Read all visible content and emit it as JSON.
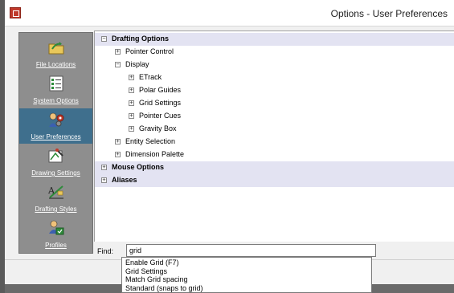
{
  "window": {
    "title": "Options - User Preferences"
  },
  "left_nav": {
    "items": [
      {
        "label": "File Locations",
        "icon": "folder-arrow-icon",
        "selected": false
      },
      {
        "label": "System Options",
        "icon": "checklist-icon",
        "selected": false
      },
      {
        "label": "User Preferences",
        "icon": "user-gears-icon",
        "selected": true
      },
      {
        "label": "Drawing Settings",
        "icon": "drawing-settings-icon",
        "selected": false
      },
      {
        "label": "Drafting Styles",
        "icon": "drafting-styles-icon",
        "selected": false
      },
      {
        "label": "Profiles",
        "icon": "profiles-icon",
        "selected": false
      }
    ]
  },
  "tree": {
    "rows": [
      {
        "label": "Drafting Options",
        "level": 0,
        "expanded": true,
        "bold": true,
        "highlight": true
      },
      {
        "label": "Pointer Control",
        "level": 1,
        "expanded": false,
        "bold": false,
        "highlight": false
      },
      {
        "label": "Display",
        "level": 1,
        "expanded": true,
        "bold": false,
        "highlight": false
      },
      {
        "label": "ETrack",
        "level": 2,
        "expanded": false,
        "bold": false,
        "highlight": false
      },
      {
        "label": "Polar Guides",
        "level": 2,
        "expanded": false,
        "bold": false,
        "highlight": false
      },
      {
        "label": "Grid Settings",
        "level": 2,
        "expanded": false,
        "bold": false,
        "highlight": false
      },
      {
        "label": "Pointer Cues",
        "level": 2,
        "expanded": false,
        "bold": false,
        "highlight": false
      },
      {
        "label": "Gravity Box",
        "level": 2,
        "expanded": false,
        "bold": false,
        "highlight": false
      },
      {
        "label": "Entity Selection",
        "level": 1,
        "expanded": false,
        "bold": false,
        "highlight": false
      },
      {
        "label": "Dimension Palette",
        "level": 1,
        "expanded": false,
        "bold": false,
        "highlight": false
      },
      {
        "label": "Mouse Options",
        "level": 0,
        "expanded": false,
        "bold": true,
        "highlight": true
      },
      {
        "label": "Aliases",
        "level": 0,
        "expanded": false,
        "bold": true,
        "highlight": true
      }
    ]
  },
  "find": {
    "label": "Find:",
    "value": "grid",
    "suggestions": [
      "Enable Grid (F7)",
      "Grid Settings",
      "Match Grid spacing",
      "Standard (snaps to grid)"
    ]
  },
  "colors": {
    "nav_bg": "#8e8e8e",
    "nav_selected": "#3f6f8d",
    "tree_highlight": "#e3e3f2",
    "app_icon": "#c0392b"
  }
}
